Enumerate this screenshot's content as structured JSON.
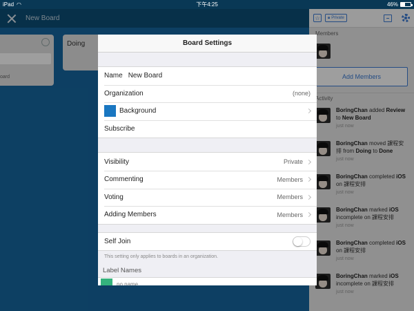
{
  "status_bar": {
    "device": "iPad",
    "time": "下午4:25",
    "battery": "46%",
    "battery_level": 0.46
  },
  "board": {
    "title": "New Board",
    "lists": [
      {
        "clipped_text": "oard"
      },
      {
        "name": "Doing"
      }
    ]
  },
  "panel": {
    "private_label": "Private",
    "members_heading": "Members",
    "add_members_label": "Add Members",
    "activity_heading": "Activity",
    "activity": [
      {
        "user": "BoringChan",
        "parts": [
          " added ",
          "Review",
          " to ",
          "New Board"
        ],
        "when": "just now"
      },
      {
        "user": "BoringChan",
        "parts": [
          " moved 課程安排 from ",
          "Doing",
          " to ",
          "Done"
        ],
        "when": "just now"
      },
      {
        "user": "BoringChan",
        "parts": [
          " completed ",
          "iOS",
          " on 課程安排",
          ""
        ],
        "when": "just now"
      },
      {
        "user": "BoringChan",
        "parts": [
          " marked ",
          "iOS",
          " incomplete on 課程安排",
          ""
        ],
        "when": "just now"
      },
      {
        "user": "BoringChan",
        "parts": [
          " completed ",
          "iOS",
          " on 課程安排",
          ""
        ],
        "when": "just now"
      },
      {
        "user": "BoringChan",
        "parts": [
          " marked ",
          "iOS",
          " incomplete on 課程安排",
          ""
        ],
        "when": "just now"
      }
    ]
  },
  "modal": {
    "title": "Board Settings",
    "name_label": "Name",
    "name_value": "New Board",
    "organization_label": "Organization",
    "organization_value": "(none)",
    "background_label": "Background",
    "background_color": "#1a77c1",
    "subscribe_label": "Subscribe",
    "visibility_label": "Visibility",
    "visibility_value": "Private",
    "commenting_label": "Commenting",
    "commenting_value": "Members",
    "voting_label": "Voting",
    "voting_value": "Members",
    "adding_members_label": "Adding Members",
    "adding_members_value": "Members",
    "self_join_label": "Self Join",
    "self_join_on": false,
    "self_join_hint": "This setting only applies to boards in an organization.",
    "label_names_heading": "Label Names",
    "label_placeholder": "no name",
    "label_color": "#34b27d"
  }
}
